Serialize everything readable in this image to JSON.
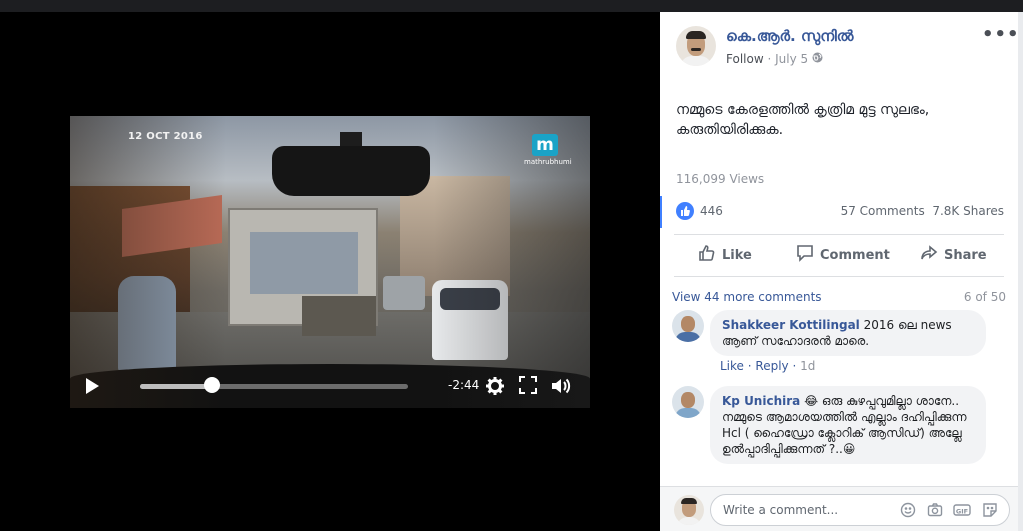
{
  "video": {
    "date_overlay": "12 OCT 2016",
    "logo_letter": "m",
    "logo_text": "mathrubhumi",
    "time_remaining": "-2:44",
    "progress": 0.27
  },
  "post": {
    "author": "കെ.ആർ. സുനിൽ",
    "follow_label": "Follow",
    "separator": "·",
    "date": "July 5",
    "privacy_icon": "globe-icon",
    "more_label": "•••",
    "text": "നമ്മുടെ കേരളത്തിൽ കൃത്രിമ മുട്ട സുലഭം, കരുതിയിരിക്കുക.",
    "views": "116,099 Views",
    "like_count": "446",
    "comments": "57 Comments",
    "shares": "7.8K Shares",
    "actions": {
      "like": "Like",
      "comment": "Comment",
      "share": "Share"
    }
  },
  "comments_section": {
    "view_more": "View 44 more comments",
    "counter": "6 of 50",
    "items": [
      {
        "name": "Shakkeer Kottilingal",
        "text": "2016 ലെ news ആണ് സഹോദരൻ മാരെ.",
        "like": "Like",
        "reply": "Reply",
        "time": "1d"
      },
      {
        "name": "Kp Unichira",
        "text": "😂 ഒരു കുഴപ്പവുമില്ലാ ശാനേ.. നമ്മുടെ ആമാശയത്തിൽ എല്ലാം ദഹിപ്പിക്കുന്ന Hcl ( ഹൈഡ്രോ ക്ലോറിക് ആസിഡ്) അല്ലേ ഉൽപ്പാദിപ്പിക്കുന്നത് ?..😀"
      }
    ],
    "composer_placeholder": "Write a comment...",
    "composer_icons": [
      "emoji-icon",
      "camera-icon",
      "gif-icon",
      "sticker-icon"
    ]
  },
  "colors": {
    "link": "#385898",
    "accent": "#4080ff",
    "muted": "#90949c"
  }
}
